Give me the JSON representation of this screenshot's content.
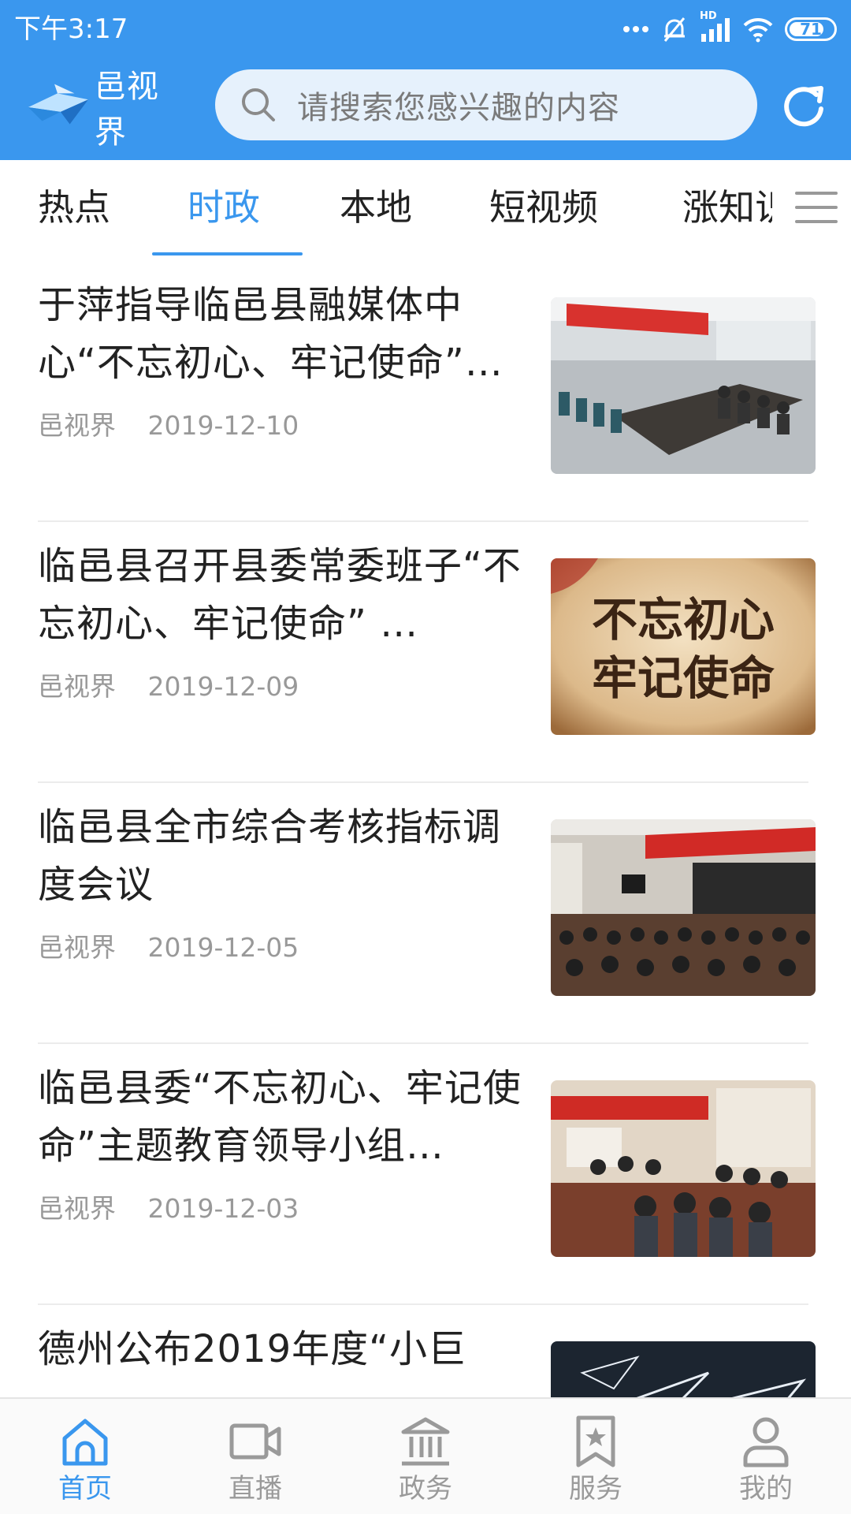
{
  "status_bar": {
    "time": "下午3:17",
    "network": "HD",
    "battery": "71"
  },
  "app_bar": {
    "app_name": "邑视界",
    "search_placeholder": "请搜索您感兴趣的内容"
  },
  "tabs": [
    {
      "label": "热点",
      "active": false
    },
    {
      "label": "时政",
      "active": true
    },
    {
      "label": "本地",
      "active": false
    },
    {
      "label": "短视频",
      "active": false
    },
    {
      "label": "涨知识",
      "active": false
    }
  ],
  "news": [
    {
      "title": "于萍指导临邑县融媒体中心“不忘初心、牢记使命”…",
      "source": "邑视界",
      "date": "2019-12-10",
      "thumb": "meeting room with red banner"
    },
    {
      "title": "临邑县召开县委常委班子“不忘初心、牢记使命” …",
      "source": "邑视界",
      "date": "2019-12-09",
      "thumb": "calligraphy",
      "thumb_text_line1": "不忘初心",
      "thumb_text_line2": "牢记使命"
    },
    {
      "title": "临邑县全市综合考核指标调度会议",
      "source": "邑视界",
      "date": "2019-12-05",
      "thumb": "conference hall"
    },
    {
      "title": "临邑县委“不忘初心、牢记使命”主题教育领导小组…",
      "source": "邑视界",
      "date": "2019-12-03",
      "thumb": "meeting with officials"
    },
    {
      "title": "德州公布2019年度“小巨",
      "source": "",
      "date": "",
      "thumb": "paper planes"
    }
  ],
  "bottom_nav": [
    {
      "label": "首页",
      "icon": "home-icon",
      "active": true
    },
    {
      "label": "直播",
      "icon": "video-camera-icon",
      "active": false
    },
    {
      "label": "政务",
      "icon": "government-building-icon",
      "active": false
    },
    {
      "label": "服务",
      "icon": "bookmark-star-icon",
      "active": false
    },
    {
      "label": "我的",
      "icon": "user-icon",
      "active": false
    }
  ],
  "colors": {
    "primary": "#3a97ee",
    "search_bg": "#e6f1fc",
    "muted_text": "#999999"
  }
}
